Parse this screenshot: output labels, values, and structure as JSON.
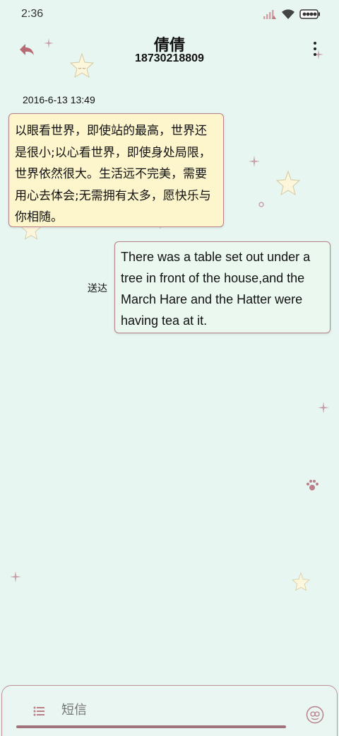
{
  "status_bar": {
    "time": "2:36",
    "icons": [
      "signal-icon",
      "wifi-icon",
      "battery-icon"
    ]
  },
  "header": {
    "contact_name": "倩倩",
    "contact_number": "18730218809",
    "back_icon": "back-arrow-icon",
    "menu_icon": "more-vertical-icon"
  },
  "conversation": {
    "timestamp": "2016-6-13 13:49",
    "messages": [
      {
        "direction": "incoming",
        "text": "以眼看世界，即使站的最高，世界还是很小;以心看世界，即使身处局限，世界依然很大。生活远不完美，需要用心去体会;无需拥有太多，愿快乐与你相随。"
      },
      {
        "direction": "outgoing",
        "text": "There was a table set out under a tree in front of the house,and the March Hare and the Hatter were having tea at it.",
        "status": "送达"
      }
    ]
  },
  "composer": {
    "placeholder": "短信",
    "list_icon": "list-icon",
    "emoji_icon": "emoji-icon"
  },
  "colors": {
    "background": "#e8f6f1",
    "incoming_bubble": "#fdf5cc",
    "outgoing_bubble": "#eaf8ef",
    "accent": "#b9808a"
  }
}
